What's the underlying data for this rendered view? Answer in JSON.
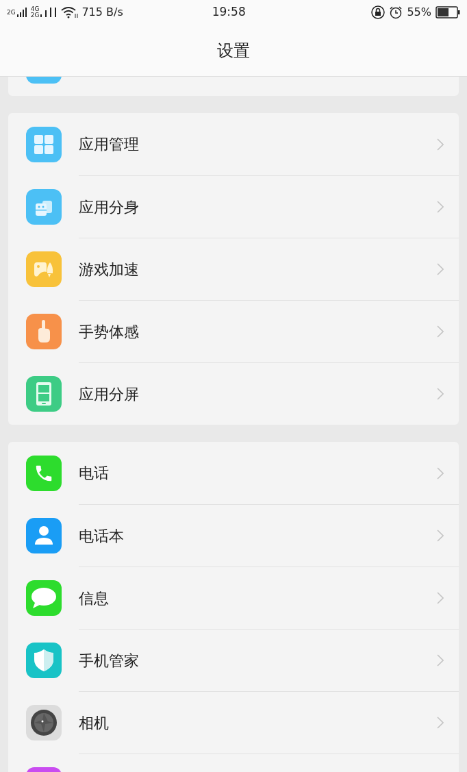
{
  "status_bar": {
    "sim1": "2G",
    "sim2_top": "4G",
    "sim2_bottom": "2G",
    "speed": "715 B/s",
    "time": "19:58",
    "battery": "55%"
  },
  "title": "设置",
  "groups": [
    {
      "items": [
        {
          "label": "应用管理"
        },
        {
          "label": "应用分身"
        },
        {
          "label": "游戏加速"
        },
        {
          "label": "手势体感"
        },
        {
          "label": "应用分屏"
        }
      ]
    },
    {
      "items": [
        {
          "label": "电话"
        },
        {
          "label": "电话本"
        },
        {
          "label": "信息"
        },
        {
          "label": "手机管家"
        },
        {
          "label": "相机"
        }
      ]
    }
  ]
}
